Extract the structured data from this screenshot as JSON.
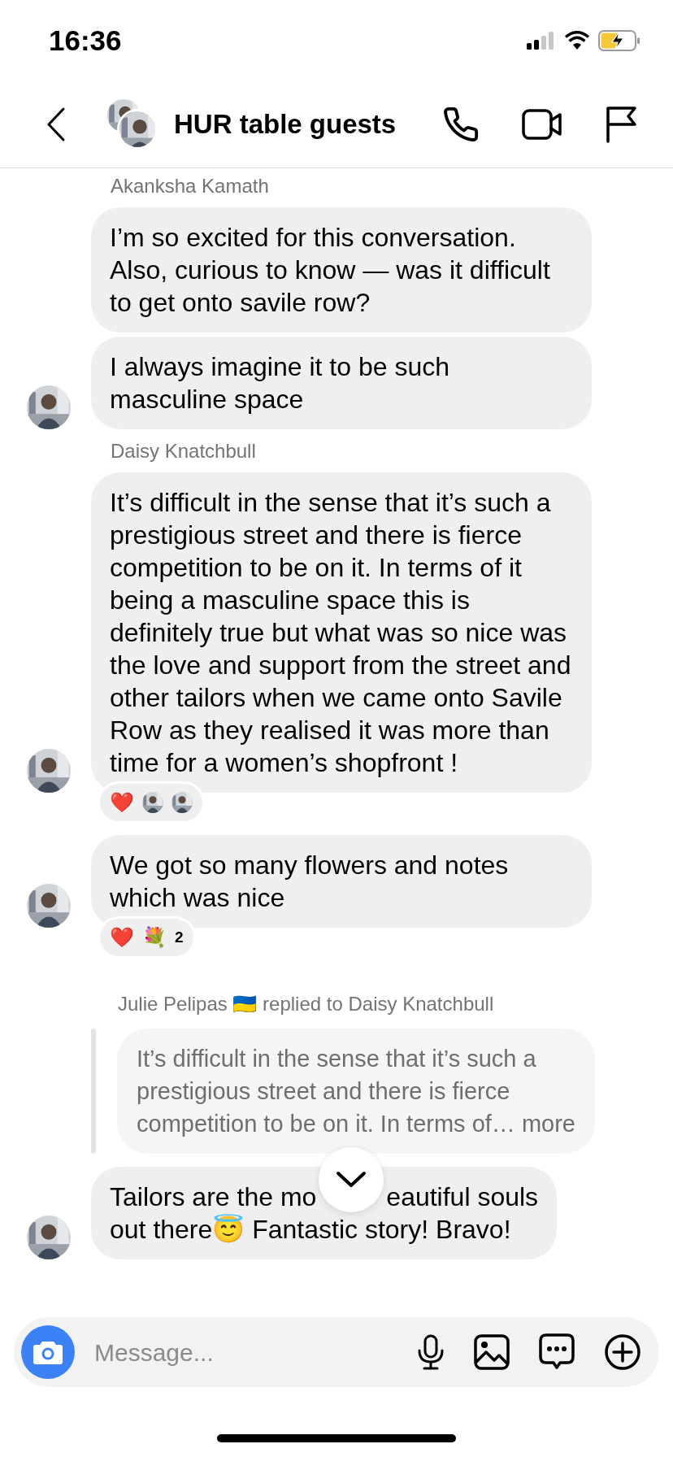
{
  "status_bar": {
    "time": "16:36"
  },
  "header": {
    "title": "HUR table guests"
  },
  "messages": [
    {
      "kind": "sender",
      "text": "Akanksha Kamath"
    },
    {
      "kind": "bubble",
      "text": "I’m so excited for this conversation. Also, curious to know — was it difficult to get onto savile row?",
      "avatar": false
    },
    {
      "kind": "bubble",
      "text": "I always imagine it to be such masculine space",
      "avatar": true
    },
    {
      "kind": "sender",
      "text": "Daisy Knatchbull"
    },
    {
      "kind": "bubble",
      "text": "It’s difficult in the sense that it’s such a prestigious street and there is fierce competition to be on it. In terms of it being a masculine space this is definitely true but what was so nice was the love and support from the street and other tailors when we came onto Savile Row as they realised it was more than time for a women’s shopfront !",
      "avatar": true,
      "reactions": [
        {
          "kind": "emoji",
          "text": "❤️"
        },
        {
          "kind": "avatar"
        },
        {
          "kind": "avatar"
        }
      ]
    },
    {
      "kind": "bubble",
      "text": "We got so many flowers and notes which was nice",
      "avatar": true,
      "reactions": [
        {
          "kind": "emoji",
          "text": "❤️"
        },
        {
          "kind": "emoji",
          "text": "💐"
        },
        {
          "kind": "count",
          "text": "2"
        }
      ]
    },
    {
      "kind": "reply_header",
      "text": "Julie Pelipas 🇺🇦 replied to Daisy Knatchbull"
    },
    {
      "kind": "quote",
      "text": "It’s difficult in the sense that it’s such a prestigious street and there is fierce competition to be on it. In terms of…",
      "more": "more"
    },
    {
      "kind": "covered_bubble",
      "text_before": "Tailors are the mo",
      "text_after": "eautiful souls",
      "text_rest": "out there😇 Fantastic story! Bravo!",
      "avatar": true
    }
  ],
  "composer": {
    "placeholder": "Message..."
  }
}
